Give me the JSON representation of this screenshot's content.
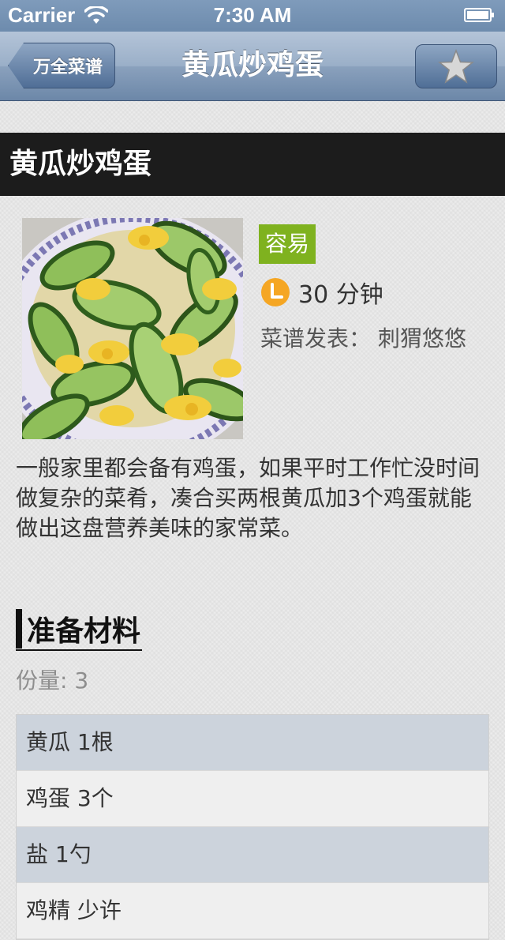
{
  "status_bar": {
    "carrier": "Carrier",
    "time": "7:30 AM"
  },
  "nav": {
    "back_label": "万全菜谱",
    "title": "黄瓜炒鸡蛋",
    "favorite_icon": "star-icon"
  },
  "recipe": {
    "name": "黄瓜炒鸡蛋",
    "difficulty": "容易",
    "cook_time": "30 分钟",
    "author_line": "菜谱发表： 刺猬悠悠",
    "description": "一般家里都会备有鸡蛋，如果平时工作忙没时间做复杂的菜肴，凑合买两根黄瓜加3个鸡蛋就能做出这盘营养美味的家常菜。"
  },
  "ingredients": {
    "heading": "准备材料",
    "servings": "份量: 3",
    "items": [
      "黄瓜 1根",
      "鸡蛋 3个",
      "盐 1勺",
      "鸡精 少许"
    ]
  },
  "colors": {
    "nav_blue": "#6c87a8",
    "difficulty_green": "#7fb21f",
    "clock_orange": "#f5a623",
    "banner_black": "#1c1c1c"
  }
}
